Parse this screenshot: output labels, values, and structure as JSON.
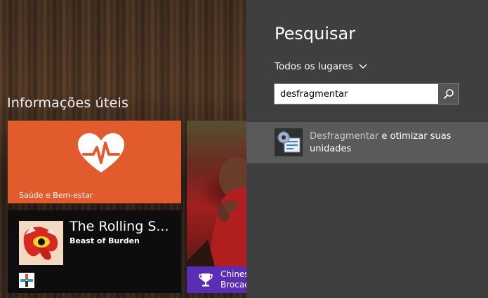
{
  "start": {
    "group_title": "Informações úteis",
    "tiles": {
      "health": {
        "label": "Saúde e Bem-estar",
        "color": "#e25b2c",
        "icon": "heart-pulse-icon"
      },
      "music": {
        "title": "The Rolling S...",
        "subtitle": "Beast of Burden",
        "color": "#0d0d0d",
        "icon": "tongue-logo-icon"
      },
      "sports": {
        "line1": "Chines",
        "line2": "Brocad",
        "band_color": "#5b2db5",
        "icon": "trophy-icon"
      }
    }
  },
  "search": {
    "title": "Pesquisar",
    "scope": "Todos os lugares",
    "query": "desfragmentar",
    "results": [
      {
        "highlight": "Desfragmentar",
        "rest": " e otimizar suas unidades",
        "icon": "defrag-drive-icon"
      }
    ]
  },
  "colors": {
    "pane_bg": "#3f3f3f",
    "result_bg": "#5a5a5a"
  }
}
